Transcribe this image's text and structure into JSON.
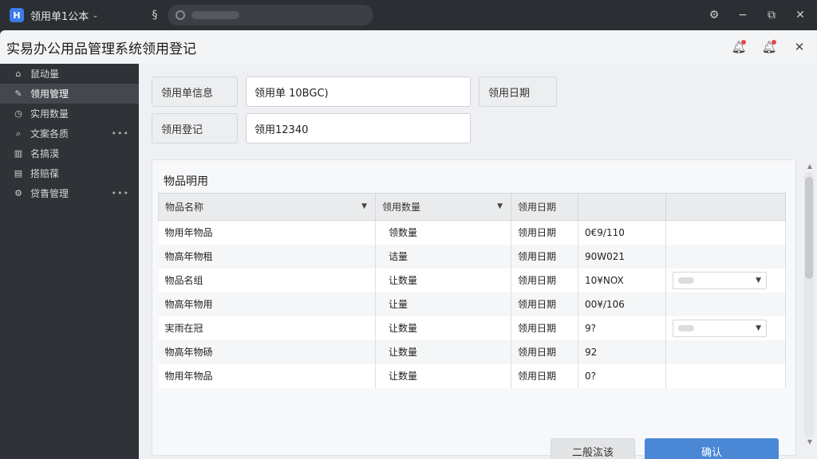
{
  "titlebar": {
    "app_title": "领用单1公本",
    "logo_glyph": "H"
  },
  "window": {
    "title": "实易办公用品管理系统领用登记"
  },
  "sidebar": {
    "items": [
      {
        "label": "鼠动量",
        "icon": "home-icon",
        "glyph": "⌂",
        "active": false,
        "more": false
      },
      {
        "label": "领用管理",
        "icon": "edit-icon",
        "glyph": "✎",
        "active": true,
        "more": false
      },
      {
        "label": "实用数量",
        "icon": "clock-icon",
        "glyph": "◷",
        "active": false,
        "more": false
      },
      {
        "label": "文案各质",
        "icon": "search-icon",
        "glyph": "⌕",
        "active": false,
        "more": true
      },
      {
        "label": "名搞漠",
        "icon": "chart-icon",
        "glyph": "▥",
        "active": false,
        "more": false
      },
      {
        "label": "搭赔葆",
        "icon": "box-icon",
        "glyph": "▤",
        "active": false,
        "more": false
      },
      {
        "label": "贷眚管理",
        "icon": "gear-icon",
        "glyph": "⚙",
        "active": false,
        "more": true
      }
    ],
    "more_glyph": "•••"
  },
  "form": {
    "info_label": "领用单信息",
    "info_value": "领用单 10BGC)",
    "date_label": "领用日期",
    "register_label": "领用登记",
    "register_value": "领用12340"
  },
  "panel": {
    "title": "物品明用",
    "columns": [
      "物品名称",
      "领用数量",
      "领用日期",
      "",
      ""
    ],
    "rows": [
      {
        "name": "物用年物品",
        "qty": "领数量",
        "date": "领用日期",
        "val": "0€9/110",
        "select": false
      },
      {
        "name": "物高年物租",
        "qty": "诘量",
        "date": "领用日期",
        "val": "90W021",
        "select": false
      },
      {
        "name": "物品名组",
        "qty": "让数量",
        "date": "领用日期",
        "val": "10¥NOX",
        "select": true
      },
      {
        "name": "物高年物用",
        "qty": "让量",
        "date": "领用日期",
        "val": "00¥/106",
        "select": false
      },
      {
        "name": "実雨在冠",
        "qty": "让数量",
        "date": "领用日期",
        "val": "9?",
        "select": true
      },
      {
        "name": "物高年物砀",
        "qty": "让数量",
        "date": "领用日期",
        "val": "92",
        "select": false
      },
      {
        "name": "物用年物品",
        "qty": "让数量",
        "date": "领用日期",
        "val": "0?",
        "select": false
      }
    ]
  },
  "buttons": {
    "secondary": "二般汯该",
    "primary": "确认"
  },
  "colors": {
    "primary": "#4a88d6",
    "titlebar_bg": "#2b2e33",
    "sidebar_bg": "#2f3338",
    "notification_dot": "#e04848"
  }
}
